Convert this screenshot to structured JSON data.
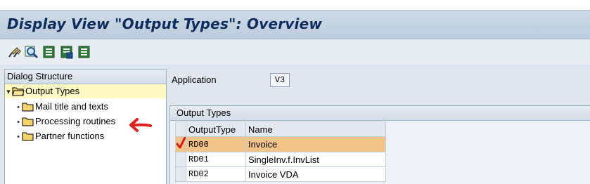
{
  "window": {
    "title": "Display View \"Output Types\": Overview"
  },
  "toolbar": {
    "buttons": [
      {
        "icon": "change-display-icon"
      },
      {
        "icon": "find-icon"
      },
      {
        "icon": "list-icon"
      },
      {
        "icon": "list-save-icon"
      },
      {
        "icon": "list-print-icon"
      }
    ]
  },
  "dialog_structure": {
    "header": "Dialog Structure",
    "items": [
      {
        "label": "Output Types",
        "expanded": true,
        "selected": true
      },
      {
        "label": "Mail title and texts"
      },
      {
        "label": "Processing routines"
      },
      {
        "label": "Partner functions"
      }
    ]
  },
  "application": {
    "label": "Application",
    "value": "V3"
  },
  "output_types": {
    "header": "Output Types",
    "columns": [
      "OutputType",
      "Name"
    ],
    "rows": [
      {
        "code": "RD00",
        "name": "Invoice"
      },
      {
        "code": "RD01",
        "name": "SingleInv.f.InvList"
      },
      {
        "code": "RD02",
        "name": "Invoice VDA"
      }
    ]
  },
  "colors": {
    "title": "#0c2d5e",
    "selected_row": "#f2c38a",
    "tree_selected": "#fff9c4",
    "annotation": "#e02020"
  }
}
